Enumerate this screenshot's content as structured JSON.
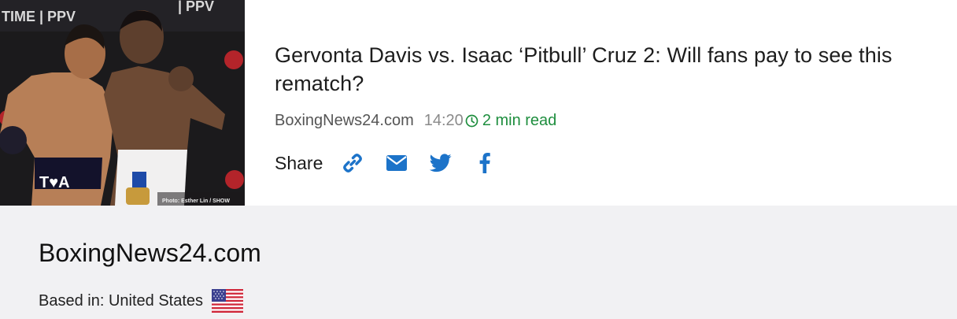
{
  "article": {
    "image_alt": "Gervonta Davis and Isaac Cruz posing",
    "image_texts": {
      "brand_left": "TIME | PPV",
      "brand_right": "| PPV",
      "trunks": "T♥A",
      "credit": "Photo: Esther Lin / SHOW"
    },
    "headline": "Gervonta Davis vs. Isaac ‘Pitbull’ Cruz 2: Will fans pay to see this rematch?",
    "source": "BoxingNews24.com",
    "time": "14:20",
    "read_time": "2 min read",
    "share_label": "Share",
    "share_buttons": [
      {
        "icon": "link-icon",
        "color": "#1c73c9"
      },
      {
        "icon": "mail-icon",
        "color": "#1c73c9"
      },
      {
        "icon": "twitter-icon",
        "color": "#1c73c9"
      },
      {
        "icon": "facebook-icon",
        "color": "#1c73c9"
      }
    ]
  },
  "publisher": {
    "name": "BoxingNews24.com",
    "based_in": "Based in: United States",
    "flag_icon": "us-flag-icon"
  },
  "colors": {
    "accent_blue": "#1c73c9",
    "read_green": "#1e8e3e",
    "panel_bg": "#f1f1f3"
  }
}
